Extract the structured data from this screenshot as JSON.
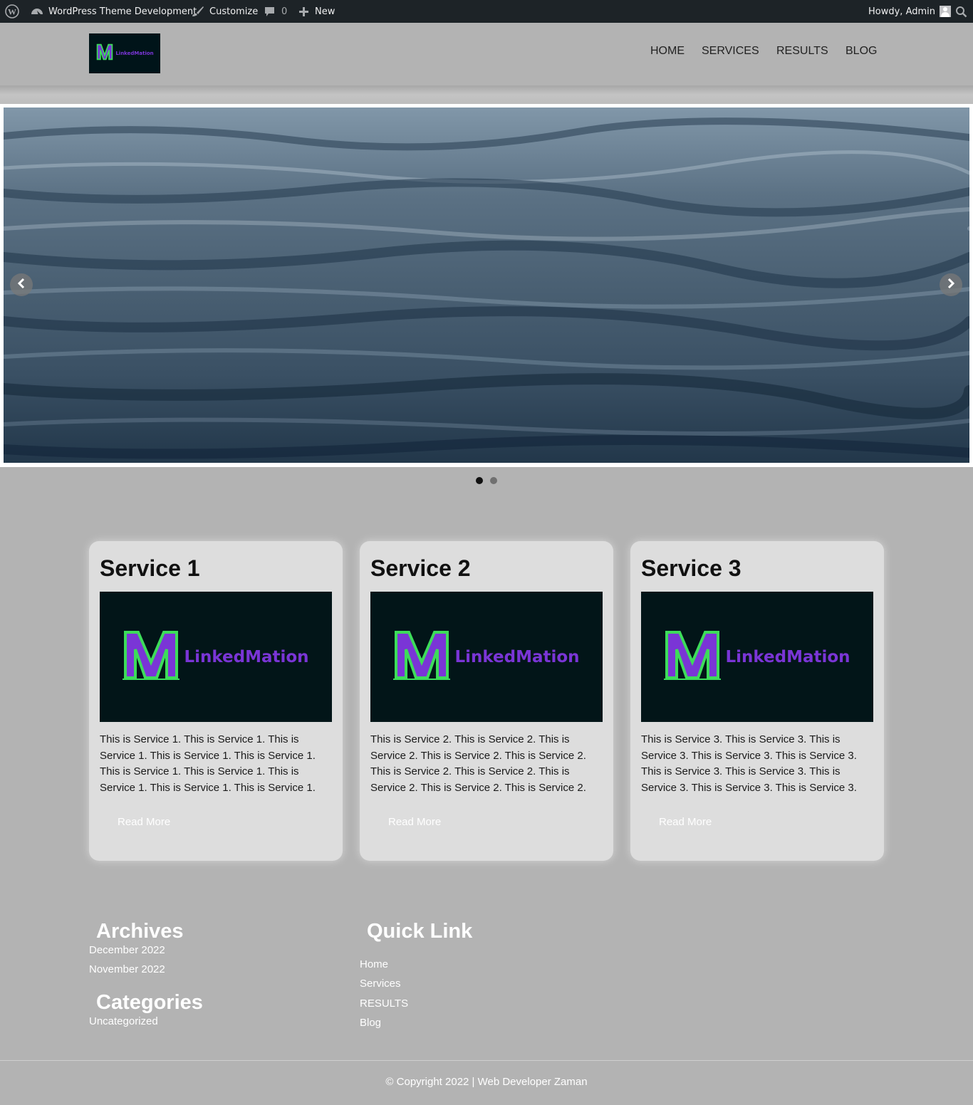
{
  "admin_bar": {
    "site_name": "WordPress Theme Development",
    "customize": "Customize",
    "comments_count": "0",
    "new_label": "New",
    "howdy": "Howdy, Admin"
  },
  "header": {
    "logo_text": "LinkedMation",
    "nav": [
      "HOME",
      "SERVICES",
      "RESULTS",
      "BLOG"
    ]
  },
  "slider": {
    "slide_count": 2,
    "active_index": 0
  },
  "services": [
    {
      "title": "Service 1",
      "image_text": "LinkedMation",
      "text": "This is Service 1. This is Service 1. This is Service 1. This is Service 1. This is Service 1. This is Service 1. This is Service 1. This is Service 1. This is Service 1. This is Service 1.",
      "button": "Read More"
    },
    {
      "title": "Service 2",
      "image_text": "LinkedMation",
      "text": "This is Service 2. This is Service 2. This is Service 2. This is Service 2. This is Service 2. This is Service 2. This is Service 2. This is Service 2. This is Service 2. This is Service 2.",
      "button": "Read More"
    },
    {
      "title": "Service 3",
      "image_text": "LinkedMation",
      "text": "This is Service 3. This is Service 3. This is Service 3. This is Service 3. This is Service 3. This is Service 3. This is Service 3. This is Service 3. This is Service 3. This is Service 3.",
      "button": "Read More"
    }
  ],
  "footer": {
    "archives_title": "Archives",
    "archives": [
      "December 2022",
      "November 2022"
    ],
    "categories_title": "Categories",
    "categories": [
      "Uncategorized"
    ],
    "quick_link_title": "Quick Link",
    "quick_links": [
      "Home",
      "Services",
      "RESULTS",
      "Blog"
    ],
    "copyright": "© Copyright 2022 | Web Developer Zaman"
  },
  "colors": {
    "admin_bar_bg": "#1d2327",
    "page_bg": "#b3b3b3",
    "card_bg": "#dddddd",
    "logo_bg": "#021518",
    "logo_green": "#3ddc5a",
    "logo_purple": "#7a35d6"
  }
}
